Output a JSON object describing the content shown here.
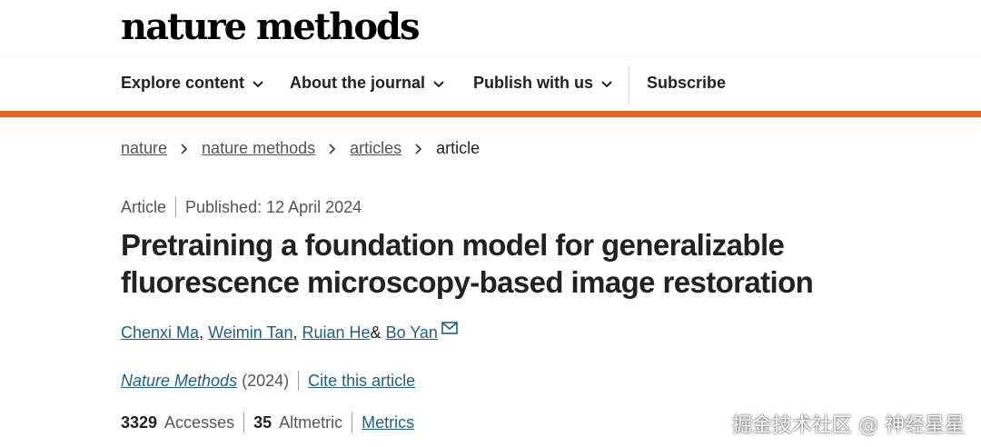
{
  "brand": {
    "logo_text": "nature methods"
  },
  "nav": {
    "items": [
      {
        "label": "Explore content",
        "has_dropdown": true
      },
      {
        "label": "About the journal",
        "has_dropdown": true
      },
      {
        "label": "Publish with us",
        "has_dropdown": true
      },
      {
        "label": "Subscribe",
        "has_dropdown": false
      }
    ]
  },
  "colors": {
    "accent_rule": "#e0632a",
    "link": "#1d5f86"
  },
  "breadcrumb": {
    "items": [
      {
        "label": "nature"
      },
      {
        "label": "nature methods"
      },
      {
        "label": "articles"
      },
      {
        "label": "article"
      }
    ]
  },
  "article": {
    "type": "Article",
    "published": "Published: 12 April 2024",
    "title": "Pretraining a foundation model for generalizable fluorescence microscopy-based image restoration",
    "authors": [
      {
        "name": "Chenxi Ma",
        "suffix": ","
      },
      {
        "name": "Weimin Tan",
        "suffix": ","
      },
      {
        "name": "Ruian He",
        "suffix": " &"
      },
      {
        "name": "Bo Yan",
        "suffix": ""
      }
    ],
    "journal": "Nature Methods",
    "year": "(2024)",
    "cite_label": "Cite this article",
    "accesses_count": "3329",
    "accesses_label": "Accesses",
    "altmetric_count": "35",
    "altmetric_label": "Altmetric",
    "metrics_label": "Metrics"
  },
  "watermark": {
    "text": "掘金技术社区 @ 神经星星"
  }
}
